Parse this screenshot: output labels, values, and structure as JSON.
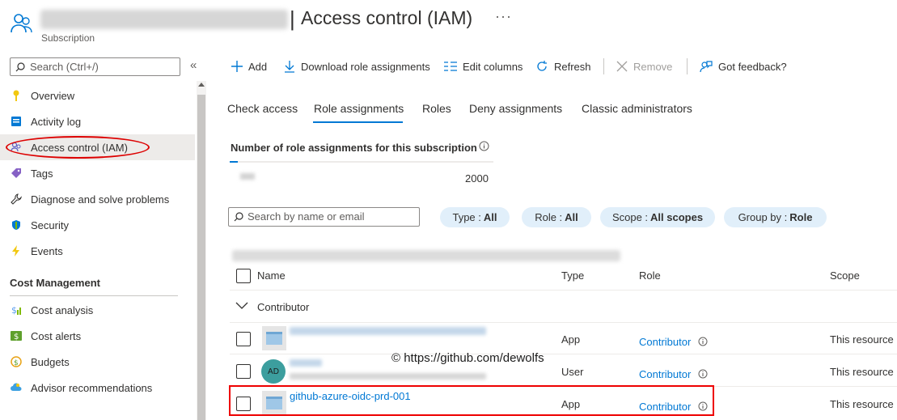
{
  "header": {
    "title": "Access control (IAM)",
    "separator": "|",
    "subtitle": "Subscription",
    "more": "···"
  },
  "sidebar": {
    "search_placeholder": "Search (Ctrl+/)",
    "collapse": "«",
    "items": [
      {
        "label": "Overview",
        "icon": "key-icon"
      },
      {
        "label": "Activity log",
        "icon": "activity-log-icon"
      },
      {
        "label": "Access control (IAM)",
        "icon": "people-icon"
      },
      {
        "label": "Tags",
        "icon": "tag-icon"
      },
      {
        "label": "Diagnose and solve problems",
        "icon": "wrench-icon"
      },
      {
        "label": "Security",
        "icon": "shield-icon"
      },
      {
        "label": "Events",
        "icon": "lightning-icon"
      }
    ],
    "section_cost": "Cost Management",
    "cost_items": [
      {
        "label": "Cost analysis",
        "icon": "cost-analysis-icon"
      },
      {
        "label": "Cost alerts",
        "icon": "cost-alerts-icon"
      },
      {
        "label": "Budgets",
        "icon": "budgets-icon"
      },
      {
        "label": "Advisor recommendations",
        "icon": "cloud-advisor-icon"
      }
    ]
  },
  "toolbar": {
    "add": "Add",
    "download": "Download role assignments",
    "edit_columns": "Edit columns",
    "refresh": "Refresh",
    "remove": "Remove",
    "feedback": "Got feedback?"
  },
  "tabs": [
    "Check access",
    "Role assignments",
    "Roles",
    "Deny assignments",
    "Classic administrators"
  ],
  "summary": {
    "title": "Number of role assignments for this subscription",
    "limit": "2000"
  },
  "filters": {
    "search_placeholder": "Search by name or email",
    "type_label": "Type :",
    "type_value": "All",
    "role_label": "Role :",
    "role_value": "All",
    "scope_label": "Scope :",
    "scope_value": "All scopes",
    "group_label": "Group by :",
    "group_value": "Role"
  },
  "table": {
    "headers": {
      "name": "Name",
      "type": "Type",
      "role": "Role",
      "scope": "Scope"
    },
    "group": "Contributor",
    "rows": [
      {
        "name": "",
        "type": "App",
        "role": "Contributor",
        "scope": "This resource"
      },
      {
        "name": "",
        "avatar": "AD",
        "type": "User",
        "role": "Contributor",
        "scope": "This resource"
      },
      {
        "name": "github-azure-oidc-prd-001",
        "type": "App",
        "role": "Contributor",
        "scope": "This resource"
      }
    ]
  },
  "watermark": "© https://github.com/dewolfs",
  "colors": {
    "accent": "#0078d4",
    "pill": "#e1effa",
    "highlight": "#dd0000"
  }
}
